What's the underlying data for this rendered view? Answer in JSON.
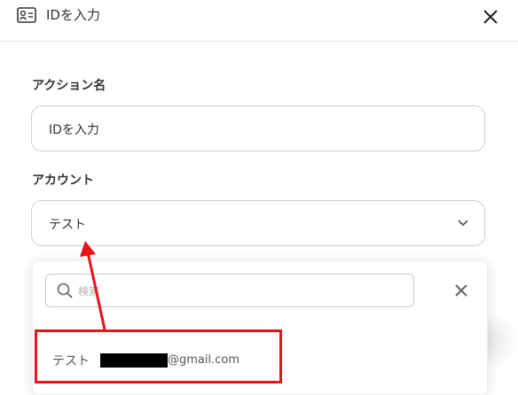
{
  "header": {
    "title": "IDを入力",
    "icon": "id-card-icon",
    "close_icon": "close-icon"
  },
  "form": {
    "action_name_label": "アクション名",
    "action_name_value": "IDを入力",
    "account_label": "アカウント",
    "account_value": "テスト"
  },
  "dropdown": {
    "search_placeholder": "検索",
    "options": [
      {
        "name": "テスト",
        "email": "@gmail.com"
      }
    ]
  },
  "annotation": {
    "color": "#e8141b"
  }
}
